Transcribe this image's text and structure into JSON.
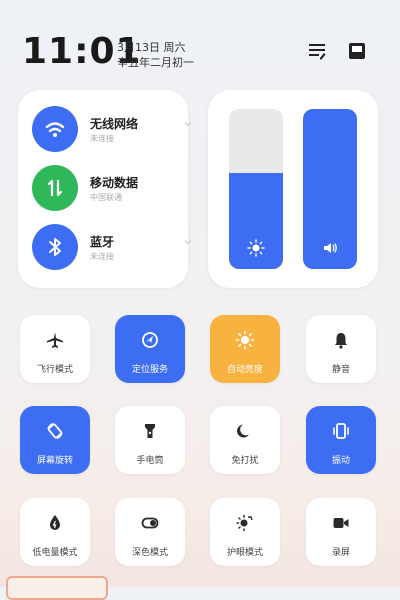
{
  "status": {
    "time": "11:01",
    "date_line1": "3月13日 周六",
    "date_line2": "辛丑年二月初一"
  },
  "connectivity": [
    {
      "title": "无线网络",
      "subtitle": "未连接",
      "icon": "wifi-icon",
      "color": "#3d6df2"
    },
    {
      "title": "移动数据",
      "subtitle": "中国联通",
      "icon": "mobile-data-icon",
      "color": "#2fb85a"
    },
    {
      "title": "蓝牙",
      "subtitle": "未连接",
      "icon": "bluetooth-icon",
      "color": "#3d6df2"
    }
  ],
  "sliders": {
    "brightness_level": 0.6,
    "volume_level": 1.0,
    "accent": "#3d6df2",
    "track": "#e9e9ec"
  },
  "tiles": [
    {
      "label": "飞行模式",
      "icon": "airplane-icon",
      "state": "off"
    },
    {
      "label": "定位服务",
      "icon": "location-icon",
      "state": "on"
    },
    {
      "label": "自动亮度",
      "icon": "auto-brightness-icon",
      "state": "on"
    },
    {
      "label": "静音",
      "icon": "bell-icon",
      "state": "off"
    },
    {
      "label": "屏幕旋转",
      "icon": "rotate-icon",
      "state": "on"
    },
    {
      "label": "手电筒",
      "icon": "flashlight-icon",
      "state": "off"
    },
    {
      "label": "免打扰",
      "icon": "moon-icon",
      "state": "off"
    },
    {
      "label": "振动",
      "icon": "vibrate-icon",
      "state": "on"
    },
    {
      "label": "低电量模式",
      "icon": "low-power-icon",
      "state": "off"
    },
    {
      "label": "深色模式",
      "icon": "dark-mode-icon",
      "state": "off"
    },
    {
      "label": "护眼模式",
      "icon": "eye-care-icon",
      "state": "off"
    },
    {
      "label": "录屏",
      "icon": "screen-record-icon",
      "state": "off"
    }
  ]
}
